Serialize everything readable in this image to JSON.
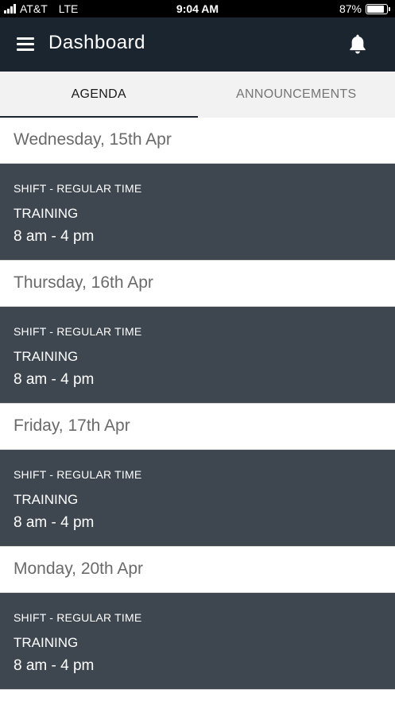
{
  "status_bar": {
    "carrier": "AT&T",
    "network": "LTE",
    "time": "9:04 AM",
    "battery_percent": "87%",
    "battery_level": 0.87
  },
  "app_bar": {
    "title": "Dashboard",
    "menu_icon": "hamburger-menu-icon",
    "notifications_icon": "bell-icon"
  },
  "tabs": [
    {
      "label": "AGENDA",
      "active": true
    },
    {
      "label": "ANNOUNCEMENTS",
      "active": false
    }
  ],
  "agenda": [
    {
      "date": "Wednesday, 15th Apr",
      "shift_type": "SHIFT - REGULAR TIME",
      "name": "TRAINING",
      "time": "8 am - 4 pm"
    },
    {
      "date": "Thursday, 16th Apr",
      "shift_type": "SHIFT - REGULAR TIME",
      "name": "TRAINING",
      "time": "8 am - 4 pm"
    },
    {
      "date": "Friday, 17th Apr",
      "shift_type": "SHIFT - REGULAR TIME",
      "name": "TRAINING",
      "time": "8 am - 4 pm"
    },
    {
      "date": "Monday, 20th Apr",
      "shift_type": "SHIFT - REGULAR TIME",
      "name": "TRAINING",
      "time": "8 am - 4 pm"
    }
  ],
  "colors": {
    "app_bar": "#1b2530",
    "shift_card": "#3e4650",
    "tab_bar": "#f2f2f2"
  }
}
